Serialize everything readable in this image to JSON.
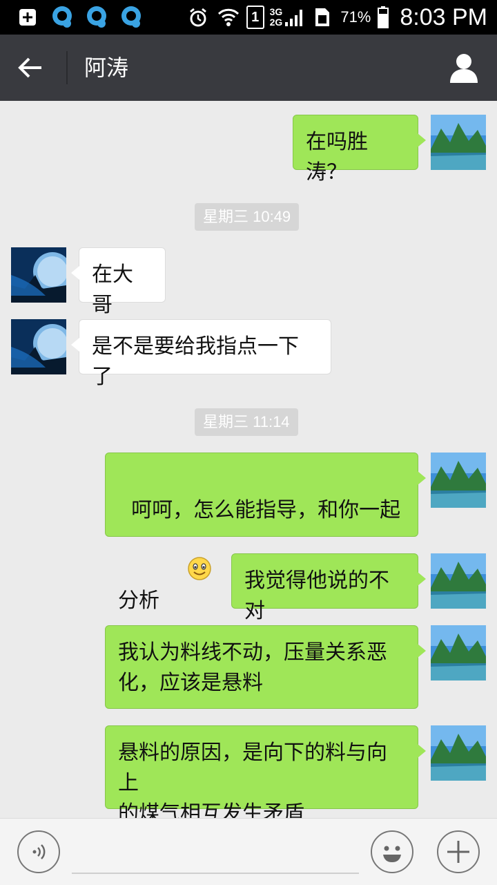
{
  "status_bar": {
    "battery_percent": "71%",
    "time": "8:03 PM",
    "sim_slot": "1",
    "network_top": "3G",
    "network_bottom": "2G",
    "icons": [
      "add-box-icon",
      "qq-icon",
      "qq-icon",
      "qq-icon",
      "alarm-icon",
      "wifi-icon",
      "sim-1-icon",
      "signal-icon",
      "sim-card-icon",
      "battery-icon"
    ]
  },
  "header": {
    "title": "阿涛",
    "back_icon": "back-arrow-icon",
    "profile_icon": "person-icon",
    "background": "#393a3f"
  },
  "messages": [
    {
      "side": "sent",
      "text": "在吗胜涛？"
    },
    {
      "type": "timestamp",
      "text": "星期三 10:49"
    },
    {
      "side": "received",
      "text": "在大哥"
    },
    {
      "side": "received",
      "text": "是不是要给我指点一下了"
    },
    {
      "type": "timestamp",
      "text": "星期三 11:14"
    },
    {
      "side": "sent",
      "text": "呵呵，怎么能指导，和你一起\n分析",
      "emoji": "smile-emoji-icon"
    },
    {
      "side": "sent",
      "text": "我觉得他说的不对"
    },
    {
      "side": "sent",
      "text": "我认为料线不动，压量关系恶\n化，应该是悬料"
    },
    {
      "side": "sent",
      "text": "悬料的原因，是向下的料与向上\n的煤气相互发生矛盾"
    }
  ],
  "bottom_bar": {
    "voice_icon": "voice-icon",
    "emoji_icon": "emoji-icon",
    "plus_icon": "plus-icon",
    "input_value": ""
  },
  "colors": {
    "sent_bubble": "#9fe658",
    "received_bubble": "#ffffff",
    "chat_background": "#ebebeb"
  }
}
